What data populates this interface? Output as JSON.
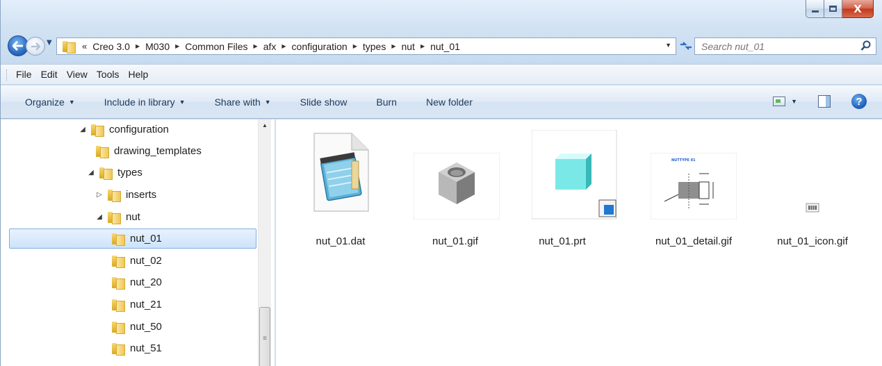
{
  "window": {
    "minimize_label": "minimize",
    "maximize_label": "maximize",
    "close_label": "X"
  },
  "address_bar": {
    "overflow": "«",
    "crumbs": [
      "Creo 3.0",
      "M030",
      "Common Files",
      "afx",
      "configuration",
      "types",
      "nut",
      "nut_01"
    ]
  },
  "search": {
    "placeholder": "Search nut_01"
  },
  "menu": [
    "File",
    "Edit",
    "View",
    "Tools",
    "Help"
  ],
  "toolbar": {
    "organize": "Organize",
    "include_in_library": "Include in library",
    "share_with": "Share with",
    "slide_show": "Slide show",
    "burn": "Burn",
    "new_folder": "New folder"
  },
  "tree": [
    {
      "label": "configuration",
      "expanded": "open"
    },
    {
      "label": "drawing_templates",
      "expanded": "none"
    },
    {
      "label": "types",
      "expanded": "open"
    },
    {
      "label": "inserts",
      "expanded": "closed"
    },
    {
      "label": "nut",
      "expanded": "open"
    },
    {
      "label": "nut_01",
      "expanded": "none",
      "selected": true
    },
    {
      "label": "nut_02",
      "expanded": "none"
    },
    {
      "label": "nut_20",
      "expanded": "none"
    },
    {
      "label": "nut_21",
      "expanded": "none"
    },
    {
      "label": "nut_50",
      "expanded": "none"
    },
    {
      "label": "nut_51",
      "expanded": "none"
    }
  ],
  "files": [
    {
      "name": "nut_01.dat",
      "icon": "notepad-icon"
    },
    {
      "name": "nut_01.gif",
      "icon": "hex-nut-thumbnail"
    },
    {
      "name": "nut_01.prt",
      "icon": "creo-part-thumbnail"
    },
    {
      "name": "nut_01_detail.gif",
      "icon": "nut-drawing-thumbnail",
      "thumb_title": "NUTTYPE 01"
    },
    {
      "name": "nut_01_icon.gif",
      "icon": "small-gif-thumbnail"
    }
  ],
  "colors": {
    "accent": "#2c6cc4",
    "selection": "#cde3fb",
    "close": "#c2381c"
  }
}
